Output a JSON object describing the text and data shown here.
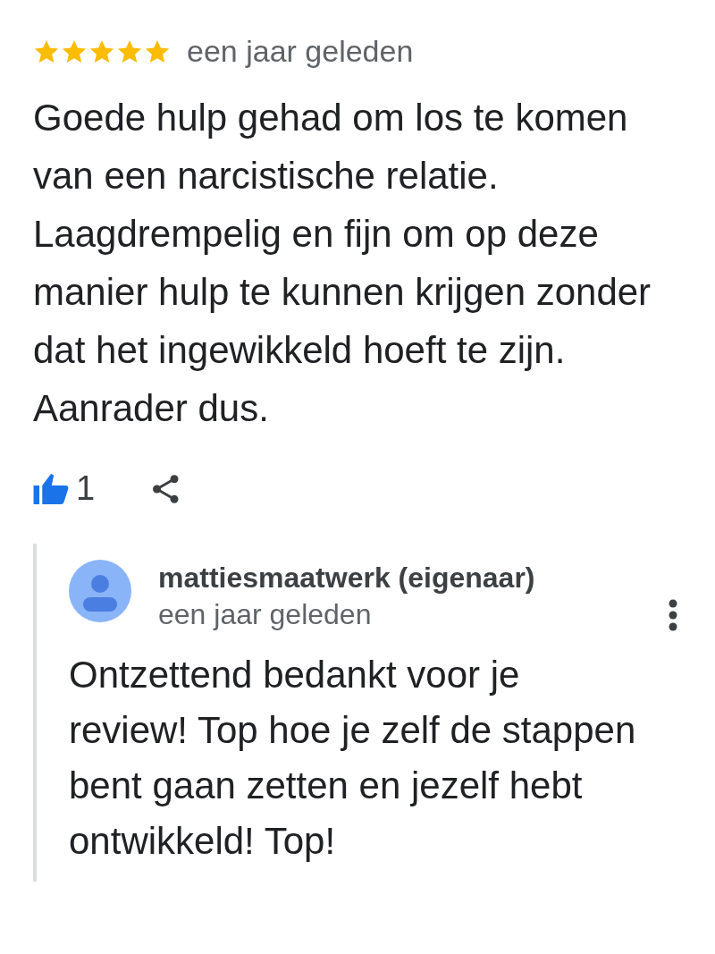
{
  "review": {
    "stars": 5,
    "time": "een jaar geleden",
    "text": "Goede hulp gehad om los te komen van een narcistische relatie. Laagdrempelig en fijn om op deze manier hulp te kunnen krijgen zonder dat het ingewikkeld hoeft te zijn. Aanrader dus.",
    "likes": "1",
    "liked": true
  },
  "owner_reply": {
    "author": "mattiesmaatwerk (eigenaar)",
    "time": "een jaar geleden",
    "text": "Ontzettend bedankt voor je review! Top hoe je zelf de stappen bent gaan zetten en jezelf hebt ontwikkeld! Top!"
  }
}
